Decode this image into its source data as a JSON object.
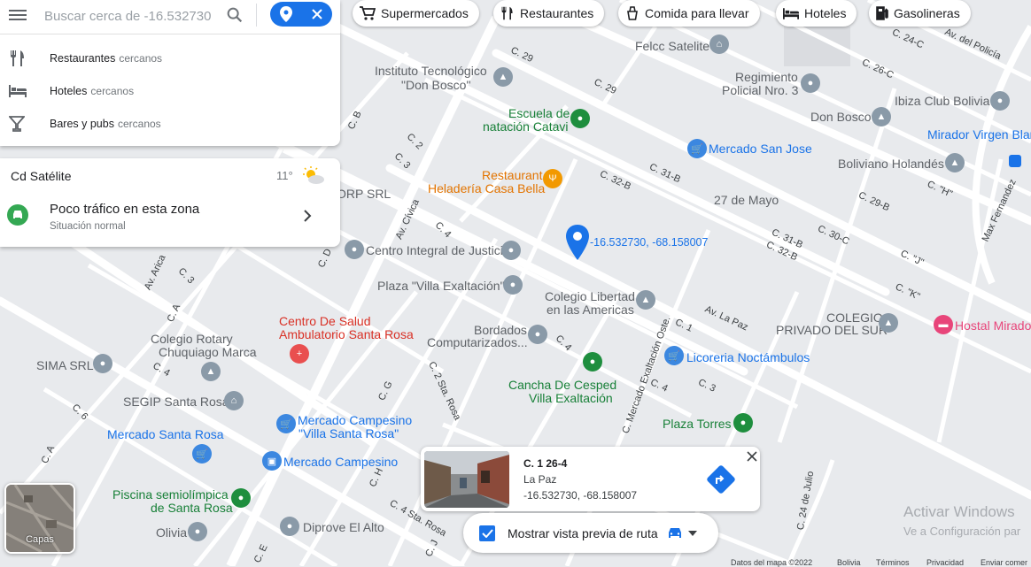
{
  "search": {
    "placeholder": "Buscar cerca de -16.532730",
    "menu_icon": "hamburger-menu-icon",
    "search_icon": "search-icon"
  },
  "nearby": [
    {
      "label": "Restaurantes",
      "suffix": "cercanos",
      "icon": "fork-knife-icon"
    },
    {
      "label": "Hoteles",
      "suffix": "cercanos",
      "icon": "bed-icon"
    },
    {
      "label": "Bares y pubs",
      "suffix": "cercanos",
      "icon": "cocktail-icon"
    }
  ],
  "weather": {
    "place": "Cd Satélite",
    "temp": "11°",
    "icon": "partly-cloudy-icon",
    "traffic_title": "Poco tráfico en esta zona",
    "traffic_sub": "Situación normal"
  },
  "chips": [
    {
      "label": "Supermercados",
      "icon": "cart-icon"
    },
    {
      "label": "Restaurantes",
      "icon": "fork-knife-icon"
    },
    {
      "label": "Comida para llevar",
      "icon": "takeout-icon"
    },
    {
      "label": "Hoteles",
      "icon": "bed-icon"
    },
    {
      "label": "Gasolineras",
      "icon": "gas-pump-icon"
    }
  ],
  "map_labels": {
    "felcc": "Felcc Satelite",
    "instituto1": "Instituto Tecnológico",
    "instituto2": "\"Don Bosco\"",
    "regimiento1": "Regimiento",
    "regimiento2": "Policial Nro. 3",
    "ibiza": "Ibiza Club Bolivia",
    "donbosco": "Don Bosco",
    "mirador": "Mirador Virgen Blan",
    "escuela1": "Escuela de",
    "escuela2": "natación Catavi",
    "mercado_sj": "Mercado San Jose",
    "boliviano": "Boliviano Holandés",
    "rest1": "Restaurant",
    "rest2": "Heladería Casa Bella",
    "mayo": "27 de Mayo",
    "coords": "-16.532730, -68.158007",
    "orp": "ORP SRL",
    "centro_int": "Centro Integral de Justicia",
    "plaza_vex": "Plaza \"Villa Exaltación\"",
    "colegio_lib1": "Colegio Libertad",
    "colegio_lib2": "en las Americas",
    "colegio_pds1": "COLEGIO",
    "colegio_pds2": "PRIVADO DEL SUR",
    "hostal": "Hostal Mirado",
    "centro_salud1": "Centro De Salud",
    "centro_salud2": "Ambulatorio Santa Rosa",
    "bordados1": "Bordados",
    "bordados2": "Computarizados...",
    "licoreria": "Licoreria Noctámbulos",
    "colegio_rot1": "Colegio Rotary",
    "colegio_rot2": "Chuquiago Marca",
    "sima": "SIMA SRL",
    "cancha1": "Cancha De Cesped",
    "cancha2": "Villa Exaltación",
    "segip": "SEGIP Santa Rosa",
    "mercado_camp1": "Mercado Campesino",
    "mercado_camp2": "\"Villa Santa Rosa\"",
    "plaza_torres": "Plaza Torres",
    "mercado_sr": "Mercado Santa Rosa",
    "mercado_camp": "Mercado Campesino",
    "piscina1": "Piscina semiolímpica",
    "piscina2": "de Santa Rosa",
    "olivia": "Olivia",
    "diprove": "Diprove El Alto",
    "activar1": "Activar Windows",
    "activar2": "Ve a Configuración par"
  },
  "streets": {
    "c29a": "C. 29",
    "c29b": "C. 29",
    "c24c": "C. 24-C",
    "avpolicia": "Av. del Policía",
    "c26c": "C. 26-C",
    "c32b": "C. 32-B",
    "c31b": "C. 31-B",
    "c29b2": "C. 29-B",
    "c30c": "C. 30-C",
    "cH": "C. \"H\"",
    "cJ": "C. \"J\"",
    "cK": "C. \"K\"",
    "c31b2": "C. 31-B",
    "c32b2": "C. 32-B",
    "maxf": "Max Fernandez",
    "avlapaz": "Av. La Paz",
    "c1": "C. 1",
    "c3": "C. 3",
    "c4a": "C. 4",
    "c4b": "C. 4",
    "c4c": "C. 4",
    "c4d": "C. 4",
    "cB": "C. B",
    "c2": "C. 2",
    "c3b": "C. 3",
    "avcivica": "Av. Cívica",
    "avarica": "Av. Arica",
    "cD": "C. D",
    "c3c": "C. 3",
    "cA": "C. A",
    "c6": "C. 6",
    "cA2": "C. A",
    "cG": "C. G",
    "c2sta": "C. 2 Sta. Rosa",
    "cmercado": "C. Mercado Exaltación Oste.",
    "c24julio": "C. 24 de Julio",
    "cH2": "C. H",
    "c4sta": "C. 4 Sta. Rosa",
    "cE": "C. E",
    "cJ2": "C. J"
  },
  "location_card": {
    "title": "C. 1 26-4",
    "city": "La Paz",
    "coords": "-16.532730, -68.158007",
    "close_icon": "close-icon",
    "directions_icon": "directions-icon"
  },
  "preview": {
    "label": "Mostrar vista previa de ruta",
    "checked": true,
    "car_icon": "car-icon"
  },
  "layers": {
    "label": "Capas"
  },
  "footer": {
    "data": "Datos del mapa ©2022",
    "country": "Bolivia",
    "terms": "Términos",
    "privacy": "Privacidad",
    "feedback": "Enviar comer"
  },
  "colors": {
    "accent": "#1a73e8",
    "map_bg": "#e8eaed",
    "road": "#ffffff"
  }
}
